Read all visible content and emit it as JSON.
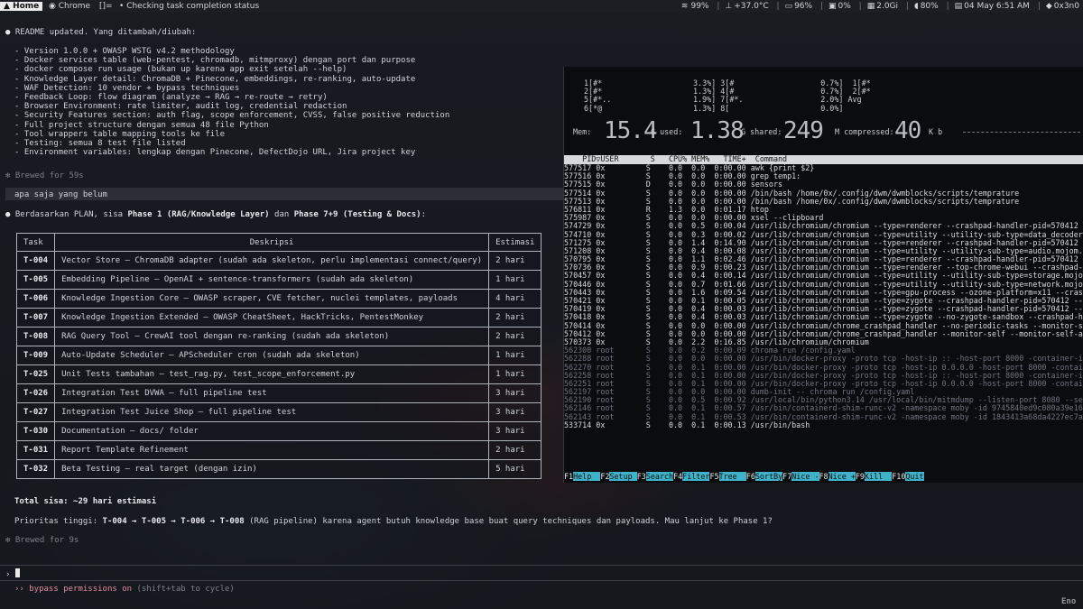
{
  "topbar": {
    "home": "Home",
    "chrome": "Chrome",
    "layout": "[]=",
    "title": "Checking task completion status",
    "status": [
      "99%",
      "+37.0°C",
      "96%",
      "0%",
      "2.0Gi",
      "80%",
      "04 May 6:51 AM",
      "0x3n0"
    ]
  },
  "claude": {
    "readme_title": "README updated. Yang ditambah/diubah:",
    "readme_items": [
      "- Version 1.0.0 + OWASP WSTG v4.2 methodology",
      "- Docker services table (web-pentest, chromadb, mitmproxy) dengan port dan purpose",
      "- docker compose run usage (bukan up karena app exit setelah --help)",
      "- Knowledge Layer detail: ChromaDB + Pinecone, embeddings, re-ranking, auto-update",
      "- WAF Detection: 10 vendor + bypass techniques",
      "- Feedback Loop: flow diagram (analyze → RAG → re-route → retry)",
      "- Browser Environment: rate limiter, audit log, credential redaction",
      "- Security Features section: auth flag, scope enforcement, CVSS, false positive reduction",
      "- Full project structure dengan semua 48 file Python",
      "- Tool wrappers table mapping tools ke file",
      "- Testing: semua 8 test file listed",
      "- Environment variables: lengkap dengan Pinecone, DefectDojo URL, Jira project key"
    ],
    "brewed1": "Brewed for 59s",
    "user_msg": "apa saja yang belum",
    "answer_intro": "Berdasarkan PLAN, sisa Phase 1 (RAG/Knowledge Layer) dan Phase 7+9 (Testing & Docs):",
    "table_headers": [
      "Task",
      "Deskripsi",
      "Estimasi"
    ],
    "tasks": [
      {
        "id": "T-004",
        "desc": "Vector Store — ChromaDB adapter (sudah ada skeleton, perlu implementasi connect/query)",
        "est": "2 hari"
      },
      {
        "id": "T-005",
        "desc": "Embedding Pipeline — OpenAI + sentence-transformers (sudah ada skeleton)",
        "est": "1 hari"
      },
      {
        "id": "T-006",
        "desc": "Knowledge Ingestion Core — OWASP scraper, CVE fetcher, nuclei templates, payloads",
        "est": "4 hari"
      },
      {
        "id": "T-007",
        "desc": "Knowledge Ingestion Extended — OWASP CheatSheet, HackTricks, PentestMonkey",
        "est": "2 hari"
      },
      {
        "id": "T-008",
        "desc": "RAG Query Tool — CrewAI tool dengan re-ranking (sudah ada skeleton)",
        "est": "2 hari"
      },
      {
        "id": "T-009",
        "desc": "Auto-Update Scheduler — APScheduler cron (sudah ada skeleton)",
        "est": "1 hari"
      },
      {
        "id": "T-025",
        "desc": "Unit Tests tambahan — test_rag.py, test_scope_enforcement.py",
        "est": "1 hari"
      },
      {
        "id": "T-026",
        "desc": "Integration Test DVWA — full pipeline test",
        "est": "3 hari"
      },
      {
        "id": "T-027",
        "desc": "Integration Test Juice Shop — full pipeline test",
        "est": "3 hari"
      },
      {
        "id": "T-030",
        "desc": "Documentation — docs/ folder",
        "est": "3 hari"
      },
      {
        "id": "T-031",
        "desc": "Report Template Refinement",
        "est": "2 hari"
      },
      {
        "id": "T-032",
        "desc": "Beta Testing — real target (dengan izin)",
        "est": "5 hari"
      }
    ],
    "total": "Total sisa: ~29 hari estimasi",
    "priority": "Prioritas tinggi: T-004 → T-005 → T-006 → T-008 (RAG pipeline) karena agent butuh knowledge base buat query techniques dan payloads. Mau lanjut ke Phase 1?",
    "brewed2": "Brewed for 9s",
    "prompt_symbol": "›",
    "bypass": "›› bypass permissions on",
    "bypass_hint": "(shift+tab to cycle)"
  },
  "htop": {
    "cpu_rows": [
      "1[#*                    3.3%] 3[#                   0.7%]  1[#*",
      "2[#*                    1.3%] 4[#                   0.7%]  2[#*",
      "5[#*..                  1.9%] 7[#*.                 2.0%] Avg",
      "6[*@                    1.3%] 8[                    0.0%]"
    ],
    "mem_label": "Mem:",
    "mem_total": "15.4",
    "used_label": "G used:",
    "used": "1.38",
    "shared_label": "G shared:",
    "shared": "249",
    "compressed_label": "M compressed:",
    "compressed": "40",
    "compressed_unit": "K b",
    "header": "    PID▽USER       S   CPU% MEM%   TIME+  Command",
    "processes": [
      {
        "t": "577517 0x         S    0.0  0.0  0:00.00 awk {print $2}",
        "g": false
      },
      {
        "t": "577516 0x         S    0.0  0.0  0:00.00 grep temp1:",
        "g": false
      },
      {
        "t": "577515 0x         D    0.0  0.0  0:00.00 sensors",
        "g": false
      },
      {
        "t": "577514 0x         S    0.0  0.0  0:00.00 /bin/bash /home/0x/.config/dwm/dwmblocks/scripts/temprature",
        "g": false
      },
      {
        "t": "577513 0x         S    0.0  0.0  0:00.00 /bin/bash /home/0x/.config/dwm/dwmblocks/scripts/temprature",
        "g": false
      },
      {
        "t": "576811 0x         R    1.3  0.0  0:01.17 htop",
        "g": false
      },
      {
        "t": "575987 0x         S    0.0  0.0  0:00.00 xsel --clipboard",
        "g": false
      },
      {
        "t": "574729 0x         S    0.0  0.5  0:00.04 /usr/lib/chromium/chromium --type=renderer --crashpad-handler-pid=570412 --en",
        "g": false
      },
      {
        "t": "574710 0x         S    0.0  0.3  0:00.02 /usr/lib/chromium/chromium --type=utility --utility-sub-type=data_decoder.mojo",
        "g": false
      },
      {
        "t": "571275 0x         S    0.0  1.4  0:14.90 /usr/lib/chromium/chromium --type=renderer --crashpad-handler-pid=570412 --en",
        "g": false
      },
      {
        "t": "571208 0x         S    0.0  0.4  0:00.08 /usr/lib/chromium/chromium --type=utility --utility-sub-type=audio.mojom.Audio",
        "g": false
      },
      {
        "t": "570795 0x         S    0.0  1.1  0:02.46 /usr/lib/chromium/chromium --type=renderer --crashpad-handler-pid=570412 --en",
        "g": false
      },
      {
        "t": "570736 0x         S    0.0  0.9  0:00.23 /usr/lib/chromium/chromium --type=renderer --top-chrome-webui --crashpad-handl",
        "g": false
      },
      {
        "t": "570457 0x         S    0.0  0.4  0:00.14 /usr/lib/chromium/chromium --type=utility --utility-sub-type=storage.mojom.Sto",
        "g": false
      },
      {
        "t": "570446 0x         S    0.0  0.7  0:01.66 /usr/lib/chromium/chromium --type=utility --utility-sub-type=network.mojom.Net",
        "g": false
      },
      {
        "t": "570443 0x         S    0.0  1.6  0:09.54 /usr/lib/chromium/chromium --type=gpu-process --ozone-platform=x11 --crashpad",
        "g": false
      },
      {
        "t": "570421 0x         S    0.0  0.1  0:00.05 /usr/lib/chromium/chromium --type=zygote --crashpad-handler-pid=570412 --enab",
        "g": false
      },
      {
        "t": "570419 0x         S    0.0  0.4  0:00.03 /usr/lib/chromium/chromium --type=zygote --crashpad-handler-pid=570412 --enab",
        "g": false
      },
      {
        "t": "570418 0x         S    0.0  0.4  0:00.03 /usr/lib/chromium/chromium --type=zygote --no-zygote-sandbox --crashpad-handle",
        "g": false
      },
      {
        "t": "570414 0x         S    0.0  0.0  0:00.00 /usr/lib/chromium/chrome_crashpad_handler --no-periodic-tasks --monitor-self-a",
        "g": false
      },
      {
        "t": "570412 0x         S    0.0  0.0  0:00.00 /usr/lib/chromium/chrome_crashpad_handler --monitor-self --monitor-self-annota",
        "g": false
      },
      {
        "t": "570373 0x         S    0.0  2.2  0:16.85 /usr/lib/chromium/chromium",
        "g": false
      },
      {
        "t": "562300 root       S    0.0  0.2  0:00.09 chroma run /config.yaml",
        "g": true
      },
      {
        "t": "562288 root       S    0.0  0.0  0:00.00 /usr/bin/docker-proxy -proto tcp -host-ip :: -host-port 8000 -container-ip 1",
        "g": true
      },
      {
        "t": "562270 root       S    0.0  0.1  0:00.00 /usr/bin/docker-proxy -proto tcp -host-ip 0.0.0.0 -host-port 8000 -container-",
        "g": true
      },
      {
        "t": "562258 root       S    0.0  0.1  0:00.00 /usr/bin/docker-proxy -proto tcp -host-ip :: -host-port 8000 -container-ip 1",
        "g": true
      },
      {
        "t": "562251 root       S    0.0  0.1  0:00.00 /usr/bin/docker-proxy -proto tcp -host-ip 0.0.0.0 -host-port 8000 -container-",
        "g": true
      },
      {
        "t": "562197 root       S    0.0  0.0  0:00.00 dumb-init -- chroma run /config.yaml",
        "g": true
      },
      {
        "t": "562190 root       S    0.0  0.5  0:00.92 /usr/local/bin/python3.14 /usr/local/bin/mitmdump --listen-port 8080 --set b",
        "g": true
      },
      {
        "t": "562146 root       S    0.0  0.1  0:00.57 /usr/bin/containerd-shim-runc-v2 -namespace moby -id 9745840ed9c080a39e162b7",
        "g": true
      },
      {
        "t": "562143 root       S    0.0  0.1  0:00.53 /usr/bin/containerd-shim-runc-v2 -namespace moby -id 1843413a68da4227ec7a898",
        "g": true
      },
      {
        "t": "533714 0x         S    0.0  0.1  0:00.13 /usr/bin/bash",
        "g": false
      }
    ],
    "fkeys": [
      {
        "k": "F1",
        "v": "Help  "
      },
      {
        "k": "F2",
        "v": "Setup "
      },
      {
        "k": "F3",
        "v": "Search"
      },
      {
        "k": "F4",
        "v": "Filter"
      },
      {
        "k": "F5",
        "v": "Tree  "
      },
      {
        "k": "F6",
        "v": "SortBy"
      },
      {
        "k": "F7",
        "v": "Nice -"
      },
      {
        "k": "F8",
        "v": "Nice +"
      },
      {
        "k": "F9",
        "v": "Kill  "
      },
      {
        "k": "F10",
        "v": "Quit"
      }
    ]
  },
  "corner_text": "Eno"
}
